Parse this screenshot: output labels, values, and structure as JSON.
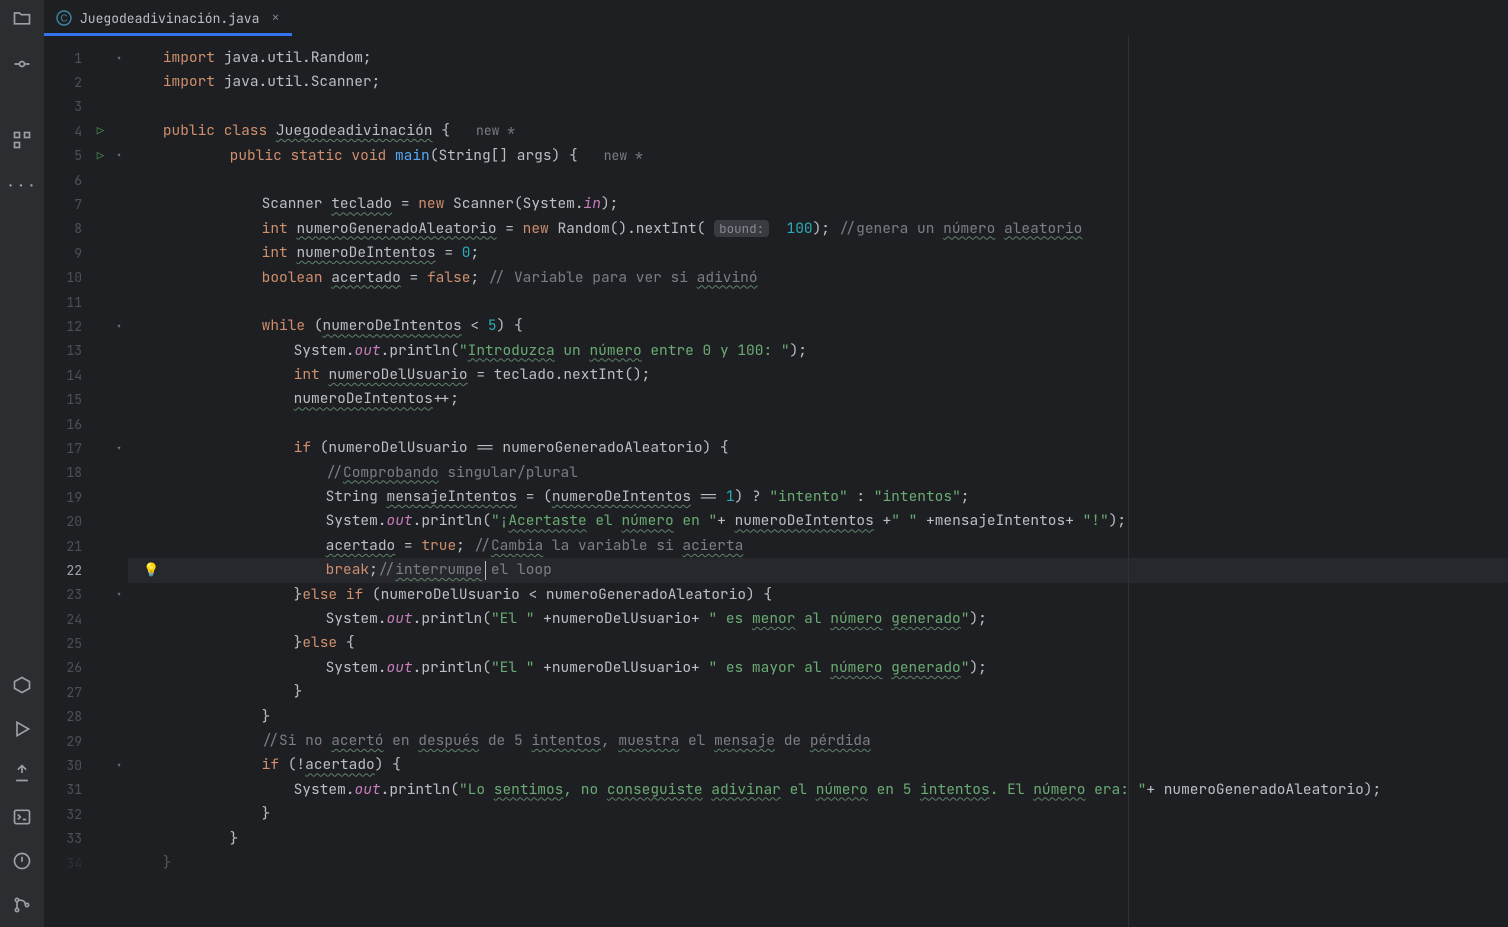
{
  "tab": {
    "name": "Juegodeadivinación.java",
    "close": "×"
  },
  "hints": {
    "bound": "bound:",
    "new": "new *"
  },
  "lines": [
    {
      "n": "1",
      "chev": "˅",
      "code": [
        [
          "kw",
          "import "
        ],
        [
          "",
          "java.util.Random;"
        ]
      ]
    },
    {
      "n": "2",
      "code": [
        [
          "kw",
          "import "
        ],
        [
          "",
          "java.util.Scanner;"
        ]
      ]
    },
    {
      "n": "3",
      "blank": true
    },
    {
      "n": "4",
      "run": "▷",
      "code": [
        [
          "kw",
          "public class "
        ],
        [
          "u",
          "Juegodeadivinación"
        ],
        [
          "",
          " {   "
        ],
        [
          "inl",
          "new *"
        ]
      ]
    },
    {
      "n": "5",
      "run": "▷",
      "chev": "˅",
      "indent": 1,
      "code": [
        [
          "kw",
          "public static void "
        ],
        [
          "fn",
          "main"
        ],
        [
          "",
          "(String[] args) {   "
        ],
        [
          "inl",
          "new *"
        ]
      ]
    },
    {
      "n": "6",
      "indent": 1,
      "blank": true
    },
    {
      "n": "7",
      "indent": 2,
      "code": [
        [
          "",
          "Scanner "
        ],
        [
          "u",
          "teclado"
        ],
        [
          "",
          " = "
        ],
        [
          "kw",
          "new "
        ],
        [
          "",
          "Scanner(System."
        ],
        [
          "purple",
          "in"
        ],
        [
          "",
          ");"
        ]
      ]
    },
    {
      "n": "8",
      "indent": 2,
      "code": [
        [
          "kw",
          "int "
        ],
        [
          "u",
          "numeroGeneradoAleatorio"
        ],
        [
          "",
          " = "
        ],
        [
          "kw",
          "new "
        ],
        [
          "",
          "Random().nextInt( "
        ],
        [
          "hint",
          "bound:"
        ],
        [
          "",
          "  "
        ],
        [
          "num",
          "100"
        ],
        [
          "",
          "); "
        ],
        [
          "cm",
          "//genera un "
        ],
        [
          "cm u",
          "número"
        ],
        [
          "cm",
          " "
        ],
        [
          "cm u",
          "aleatorio"
        ]
      ]
    },
    {
      "n": "9",
      "indent": 2,
      "code": [
        [
          "kw",
          "int "
        ],
        [
          "u",
          "numeroDeIntentos"
        ],
        [
          "",
          " = "
        ],
        [
          "num",
          "0"
        ],
        [
          "",
          ";"
        ]
      ]
    },
    {
      "n": "10",
      "indent": 2,
      "code": [
        [
          "kw",
          "boolean "
        ],
        [
          "u",
          "acertado"
        ],
        [
          "",
          " = "
        ],
        [
          "bool",
          "false"
        ],
        [
          "",
          "; "
        ],
        [
          "cm",
          "// Variable para ver si "
        ],
        [
          "cm u",
          "adivinó"
        ]
      ]
    },
    {
      "n": "11",
      "indent": 2,
      "blank": true
    },
    {
      "n": "12",
      "chev": "˅",
      "indent": 2,
      "code": [
        [
          "kw",
          "while "
        ],
        [
          "",
          "("
        ],
        [
          "u",
          "numeroDeIntentos"
        ],
        [
          "",
          " < "
        ],
        [
          "num",
          "5"
        ],
        [
          "",
          ") {"
        ]
      ]
    },
    {
      "n": "13",
      "indent": 3,
      "code": [
        [
          "",
          "System."
        ],
        [
          "purple",
          "out"
        ],
        [
          "",
          ".println("
        ],
        [
          "str",
          "\""
        ],
        [
          "str u",
          "Introduzca"
        ],
        [
          "str",
          " un "
        ],
        [
          "str u",
          "número"
        ],
        [
          "str",
          " entre 0 y 100: \""
        ],
        [
          "",
          ");"
        ]
      ]
    },
    {
      "n": "14",
      "indent": 3,
      "code": [
        [
          "kw",
          "int "
        ],
        [
          "u",
          "numeroDelUsuario"
        ],
        [
          "",
          " = teclado.nextInt();"
        ]
      ]
    },
    {
      "n": "15",
      "indent": 3,
      "code": [
        [
          "u",
          "numeroDeIntentos"
        ],
        [
          "",
          "++;"
        ]
      ]
    },
    {
      "n": "16",
      "indent": 3,
      "blank": true
    },
    {
      "n": "17",
      "chev": "˅",
      "indent": 3,
      "code": [
        [
          "kw",
          "if "
        ],
        [
          "",
          "(numeroDelUsuario == numeroGeneradoAleatorio) {"
        ]
      ]
    },
    {
      "n": "18",
      "indent": 4,
      "code": [
        [
          "cm",
          "//"
        ],
        [
          "cm u",
          "Comprobando"
        ],
        [
          "cm",
          " singular/plural"
        ]
      ]
    },
    {
      "n": "19",
      "indent": 4,
      "code": [
        [
          "",
          "String "
        ],
        [
          "u",
          "mensajeIntentos"
        ],
        [
          "",
          " = ("
        ],
        [
          "u",
          "numeroDeIntentos"
        ],
        [
          "",
          " == "
        ],
        [
          "num",
          "1"
        ],
        [
          "",
          ") ? "
        ],
        [
          "str",
          "\"intento\""
        ],
        [
          "",
          " : "
        ],
        [
          "str",
          "\"intentos\""
        ],
        [
          "",
          ";"
        ]
      ]
    },
    {
      "n": "20",
      "indent": 4,
      "code": [
        [
          "",
          "System."
        ],
        [
          "purple",
          "out"
        ],
        [
          "",
          ".println("
        ],
        [
          "str",
          "\"¡"
        ],
        [
          "str u",
          "Acertaste"
        ],
        [
          "str",
          " el "
        ],
        [
          "str u",
          "número"
        ],
        [
          "str",
          " en \""
        ],
        [
          "",
          "+ "
        ],
        [
          "u",
          "numeroDeIntentos"
        ],
        [
          "",
          " +"
        ],
        [
          "str",
          "\" \""
        ],
        [
          "",
          " +mensajeIntentos+ "
        ],
        [
          "str",
          "\"!\""
        ],
        [
          "",
          ");"
        ]
      ]
    },
    {
      "n": "21",
      "indent": 4,
      "code": [
        [
          "u",
          "acertado"
        ],
        [
          "",
          " = "
        ],
        [
          "bool",
          "true"
        ],
        [
          "",
          "; "
        ],
        [
          "cm",
          "//"
        ],
        [
          "cm u",
          "Cambia"
        ],
        [
          "cm",
          " la variable si "
        ],
        [
          "cm u",
          "acierta"
        ]
      ]
    },
    {
      "n": "22",
      "indent": 4,
      "cur": true,
      "bulb": true,
      "caret": 219,
      "code": [
        [
          "kw",
          "break"
        ],
        [
          "",
          ";"
        ],
        [
          "cm",
          "//"
        ],
        [
          "cm u",
          "interrumpe"
        ],
        [
          "cm",
          " el loop"
        ]
      ]
    },
    {
      "n": "23",
      "chev": "˅",
      "indent": 3,
      "code": [
        [
          "",
          "}"
        ],
        [
          "kw",
          "else if "
        ],
        [
          "",
          "(numeroDelUsuario < numeroGeneradoAleatorio) {"
        ]
      ]
    },
    {
      "n": "24",
      "indent": 4,
      "code": [
        [
          "",
          "System."
        ],
        [
          "purple",
          "out"
        ],
        [
          "",
          ".println("
        ],
        [
          "str",
          "\"El \""
        ],
        [
          "",
          " +numeroDelUsuario+ "
        ],
        [
          "str",
          "\" es "
        ],
        [
          "str u",
          "menor"
        ],
        [
          "str",
          " al "
        ],
        [
          "str u",
          "número"
        ],
        [
          "str",
          " "
        ],
        [
          "str u",
          "generado"
        ],
        [
          "str",
          "\""
        ],
        [
          "",
          ");"
        ]
      ]
    },
    {
      "n": "25",
      "indent": 3,
      "code": [
        [
          "",
          "}"
        ],
        [
          "kw",
          "else "
        ],
        [
          "",
          "{"
        ]
      ]
    },
    {
      "n": "26",
      "indent": 4,
      "code": [
        [
          "",
          "System."
        ],
        [
          "purple",
          "out"
        ],
        [
          "",
          ".println("
        ],
        [
          "str",
          "\"El \""
        ],
        [
          "",
          " +numeroDelUsuario+ "
        ],
        [
          "str",
          "\" es mayor al "
        ],
        [
          "str u",
          "número"
        ],
        [
          "str",
          " "
        ],
        [
          "str u",
          "generado"
        ],
        [
          "str",
          "\""
        ],
        [
          "",
          ");"
        ]
      ]
    },
    {
      "n": "27",
      "indent": 3,
      "code": [
        [
          "",
          "}"
        ]
      ]
    },
    {
      "n": "28",
      "indent": 2,
      "code": [
        [
          "",
          "}"
        ]
      ]
    },
    {
      "n": "29",
      "indent": 2,
      "code": [
        [
          "cm",
          "//Si no "
        ],
        [
          "cm u",
          "acertó"
        ],
        [
          "cm",
          " en "
        ],
        [
          "cm u",
          "después"
        ],
        [
          "cm",
          " de 5 "
        ],
        [
          "cm u",
          "intentos"
        ],
        [
          "cm",
          ", "
        ],
        [
          "cm u",
          "muestra"
        ],
        [
          "cm",
          " el "
        ],
        [
          "cm u",
          "mensaje"
        ],
        [
          "cm",
          " de "
        ],
        [
          "cm u",
          "pérdida"
        ]
      ]
    },
    {
      "n": "30",
      "chev": "˅",
      "indent": 2,
      "code": [
        [
          "kw",
          "if "
        ],
        [
          "",
          "(!"
        ],
        [
          "u",
          "acertado"
        ],
        [
          "",
          ") {"
        ]
      ]
    },
    {
      "n": "31",
      "indent": 3,
      "code": [
        [
          "",
          "System."
        ],
        [
          "purple",
          "out"
        ],
        [
          "",
          ".println("
        ],
        [
          "str",
          "\"Lo "
        ],
        [
          "str u",
          "sentimos"
        ],
        [
          "str",
          ", no "
        ],
        [
          "str u",
          "conseguiste"
        ],
        [
          "str",
          " "
        ],
        [
          "str u",
          "adivinar"
        ],
        [
          "str",
          " el "
        ],
        [
          "str u",
          "número"
        ],
        [
          "str",
          " en 5 "
        ],
        [
          "str u",
          "intentos"
        ],
        [
          "str",
          ". El "
        ],
        [
          "str u",
          "número"
        ],
        [
          "str",
          " era: \""
        ],
        [
          "",
          "+ numeroGeneradoAleatorio);"
        ]
      ]
    },
    {
      "n": "32",
      "indent": 2,
      "code": [
        [
          "",
          "}"
        ]
      ]
    },
    {
      "n": "33",
      "indent": 1,
      "code": [
        [
          "",
          "}"
        ]
      ]
    },
    {
      "n": "34",
      "code": [
        [
          "",
          "}"
        ]
      ],
      "fade": true
    }
  ]
}
